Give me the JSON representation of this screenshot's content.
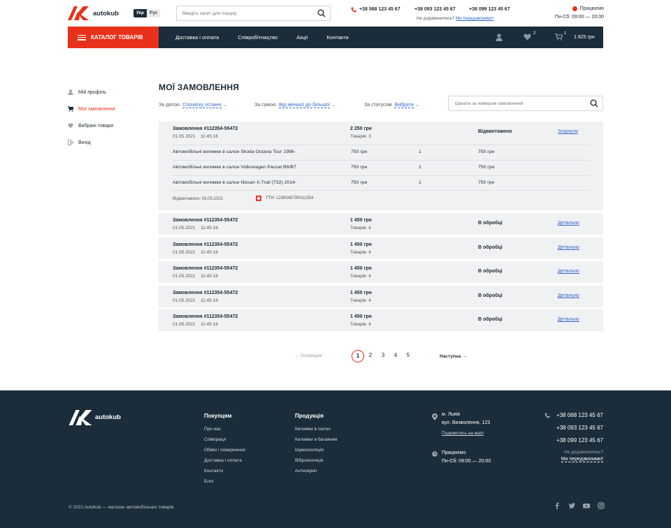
{
  "header": {
    "logo_text": "autokub",
    "lang": [
      "Укр",
      "Рус"
    ],
    "search_placeholder": "Введіть запит для пошуку",
    "phones": [
      "+38 068 123 45 67",
      "+38 093 123 45 67",
      "+38 099 123 45 67"
    ],
    "not_reached": "Не додзвонились?",
    "callback_link": "Ми передзвонимо!",
    "working_status": "Працюємо",
    "working_hours": "Пн-Сб: 09:00 — 20:00"
  },
  "nav": {
    "catalog": "КАТАЛОГ ТОВАРІВ",
    "links": [
      "Доставка і оплата",
      "Співробітництво",
      "Акції",
      "Контакти"
    ],
    "favorites_count": "2",
    "cart_count": "1",
    "cart_sum": "1 825 грн"
  },
  "sidebar": {
    "items": [
      "Мій профіль",
      "Мої замовлення",
      "Вибрані товари",
      "Вихід"
    ]
  },
  "page": {
    "title": "МОЇ ЗАМОВЛЕННЯ",
    "filters": [
      {
        "label": "За датою",
        "value": "Спочатку останні"
      },
      {
        "label": "За сумою",
        "value": "Від меншої до більшої"
      },
      {
        "label": "За статусом",
        "value": "Вибрати"
      }
    ],
    "order_search_placeholder": "Шукати за номером замовлення"
  },
  "orders": [
    {
      "number": "Замовлення #112354-55472",
      "date": "01.05.2021",
      "time": "11:45:16",
      "price": "2 250 грн",
      "qty": "Товарів: 3",
      "status": "Відвантажено",
      "action": "Згорнути",
      "items": [
        {
          "name": "Автомобільні килимки в салон Skoda Octavia Tour 1996-",
          "price": "750 грн",
          "qty": "1",
          "total": "750 грн"
        },
        {
          "name": "Автомобільні килимки в салон Volkswagen Passat B6/B7",
          "price": "750 грн",
          "qty": "1",
          "total": "750 грн"
        },
        {
          "name": "Автомобільні килимки в салон Nissan X-Trail (T32) 2014-",
          "price": "750 грн",
          "qty": "1",
          "total": "750 грн"
        }
      ],
      "shipped": "Відвантажено: 03.05.2021",
      "ttn": "ТТН: 1236548790012354"
    },
    {
      "number": "Замовлення #112354-55472",
      "date": "01.05.2021",
      "time": "11:45:16",
      "price": "1 450 грн",
      "qty": "Товарів: 4",
      "status": "В обробці",
      "action": "Детально"
    },
    {
      "number": "Замовлення #112354-55472",
      "date": "01.05.2021",
      "time": "11:45:16",
      "price": "1 450 грн",
      "qty": "Товарів: 4",
      "status": "В обробці",
      "action": "Детально"
    },
    {
      "number": "Замовлення #112354-55472",
      "date": "01.05.2021",
      "time": "11:45:16",
      "price": "1 450 грн",
      "qty": "Товарів: 4",
      "status": "В обробці",
      "action": "Детально"
    },
    {
      "number": "Замовлення #112354-55472",
      "date": "01.05.2021",
      "time": "11:45:16",
      "price": "1 450 грн",
      "qty": "Товарів: 4",
      "status": "В обробці",
      "action": "Детально"
    },
    {
      "number": "Замовлення #112354-55472",
      "date": "01.05.2021",
      "time": "11:45:16",
      "price": "1 450 грн",
      "qty": "Товарів: 4",
      "status": "В обробці",
      "action": "Детально"
    }
  ],
  "pagination": {
    "prev": "← Попередня",
    "pages": [
      "1",
      "2",
      "3",
      "4",
      "5"
    ],
    "current": "1",
    "next": "Наступна →"
  },
  "footer": {
    "logo_text": "autokub",
    "col1_title": "Покупцям",
    "col1_links": [
      "Про нас",
      "Співпраця",
      "Обмін і повернення",
      "Доставка і оплата",
      "Контакти",
      "Блог"
    ],
    "col2_title": "Продукція",
    "col2_links": [
      "Килимки в салон",
      "Килимки в багажник",
      "Шумоізоляція",
      "Віброізоляція",
      "Антискрип"
    ],
    "city": "м. Львів",
    "street": "вул. Визволення, 123",
    "map_link": "Подивитись на мапі",
    "working_status": "Працюємо",
    "working_hours": "Пн-Сб: 09:00 — 20:00",
    "phones": [
      "+38 068 123 45 67",
      "+38 093 123 45 67",
      "+38 099 123 45 67"
    ],
    "not_reached": "Не додзвонились?",
    "callback_link": "Ми передзвонимо!",
    "copyright": "© 2021 Autokub — магазин автомобільних товарів",
    "social": [
      "facebook-icon",
      "twitter-icon",
      "youtube-icon",
      "instagram-icon"
    ]
  },
  "colors": {
    "accent": "#e8311a",
    "dark": "#1b2d3a",
    "link": "#2f66d0",
    "row_bg": "#f0f1f2"
  }
}
